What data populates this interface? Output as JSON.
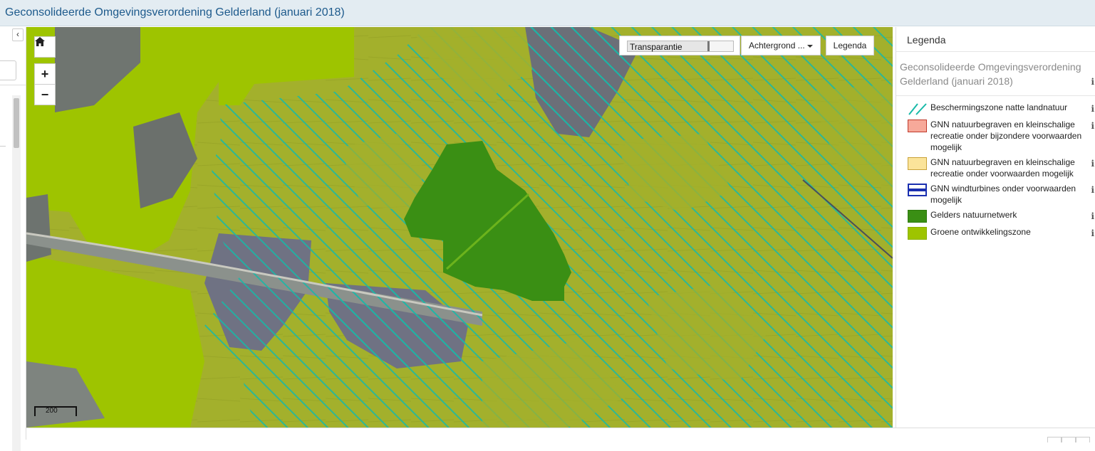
{
  "app": {
    "title": "Geconsolideerde Omgevingsverordening Gelderland (januari 2018)"
  },
  "left_panel": {
    "collapse_icon": "chevron-left-icon",
    "collapse_glyph": "‹"
  },
  "map": {
    "home_icon": "home-icon",
    "zoom_in_label": "+",
    "zoom_out_label": "−",
    "transparency": {
      "label": "Transparantie",
      "value": 0.78
    },
    "background_button": "Achtergrond ...",
    "legend_button": "Legenda",
    "scale_label": "200",
    "colors": {
      "gelders_natuurnetwerk": "#3a8f14",
      "groene_ontwikkelingszone": "#9ec400",
      "hatch": "#17b9a8",
      "satellite_field": "#a3b02c"
    }
  },
  "legend": {
    "header": "Legenda",
    "layer_title": "Geconsolideerde Omgevingsverordening Gelderland (januari 2018)",
    "info_glyph": "i",
    "items": [
      {
        "label": "Beschermingszone natte landnatuur",
        "swatch": "hatch",
        "color": "#17b9a8"
      },
      {
        "label": "GNN natuurbegraven en kleinschalige recreatie onder bijzondere voorwaarden mogelijk",
        "swatch": "fill",
        "color": "#f7a99a",
        "border": "#c0392b"
      },
      {
        "label": "GNN natuurbegraven en kleinschalige recreatie onder voorwaarden mogelijk",
        "swatch": "fill",
        "color": "#fbe49a",
        "border": "#c9a23a"
      },
      {
        "label": "GNN windturbines onder voorwaarden mogelijk",
        "swatch": "lines",
        "color": "#1a2fb0"
      },
      {
        "label": "Gelders natuurnetwerk",
        "swatch": "fill",
        "color": "#3a8f14",
        "border": "#2d7a0e"
      },
      {
        "label": "Groene ontwikkelingszone",
        "swatch": "fill",
        "color": "#9ec400",
        "border": "#8ab000"
      }
    ]
  }
}
